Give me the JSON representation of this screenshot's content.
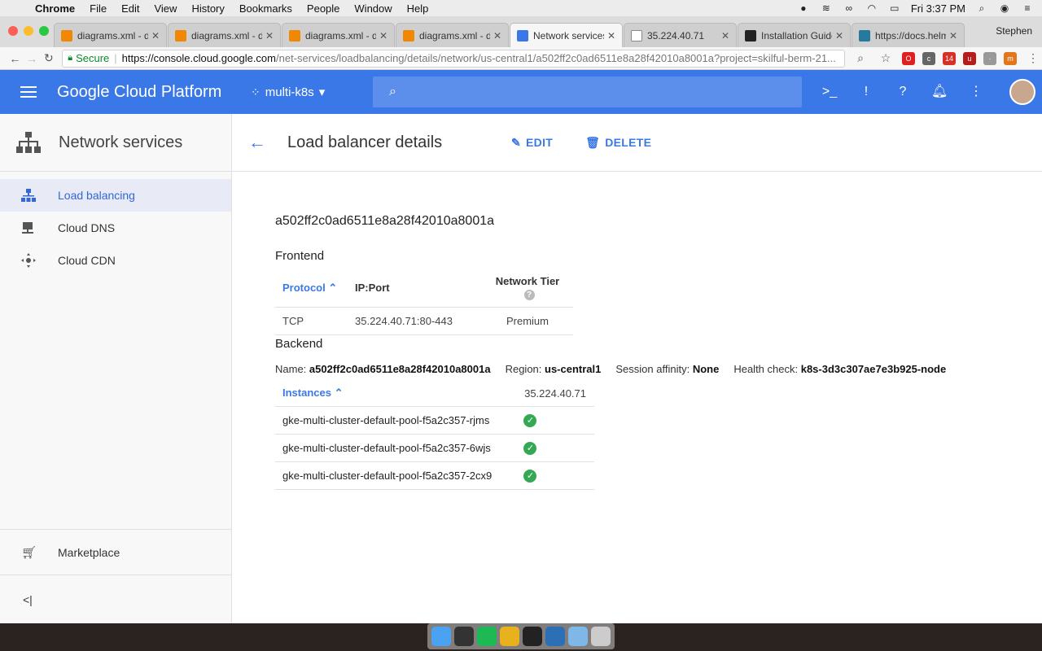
{
  "menubar": {
    "items": [
      "Chrome",
      "File",
      "Edit",
      "View",
      "History",
      "Bookmarks",
      "People",
      "Window",
      "Help"
    ],
    "clock": "Fri 3:37 PM"
  },
  "browser": {
    "tabs": [
      {
        "title": "diagrams.xml - dr",
        "icon": "drawio-icon"
      },
      {
        "title": "diagrams.xml - dr",
        "icon": "drawio-icon"
      },
      {
        "title": "diagrams.xml - dr",
        "icon": "drawio-icon"
      },
      {
        "title": "diagrams.xml - dr",
        "icon": "drawio-icon"
      },
      {
        "title": "Network services",
        "icon": "network-icon",
        "active": true
      },
      {
        "title": "35.224.40.71",
        "icon": "page-icon"
      },
      {
        "title": "Installation Guide",
        "icon": "graduation-cap-icon"
      },
      {
        "title": "https://docs.helm",
        "icon": "helm-icon"
      }
    ],
    "profile": "Stephen",
    "secure_label": "Secure",
    "url_host": "https://console.cloud.google.com",
    "url_rest": "/net-services/loadbalancing/details/network/us-central1/a502ff2c0ad6511e8a28f42010a8001a?project=skilful-berm-21..."
  },
  "gcp": {
    "brand": "Google Cloud Platform",
    "project": "multi-k8s"
  },
  "sidebar": {
    "title": "Network services",
    "items": [
      {
        "label": "Load balancing",
        "active": true
      },
      {
        "label": "Cloud DNS"
      },
      {
        "label": "Cloud CDN"
      }
    ],
    "marketplace": "Marketplace",
    "collapse": "<|"
  },
  "page": {
    "title": "Load balancer details",
    "edit_label": "EDIT",
    "delete_label": "DELETE",
    "lb_name": "a502ff2c0ad6511e8a28f42010a8001a"
  },
  "frontend": {
    "title": "Frontend",
    "headers": {
      "protocol": "Protocol",
      "ipport": "IP:Port",
      "tier": "Network Tier"
    },
    "rows": [
      {
        "protocol": "TCP",
        "ipport": "35.224.40.71:80-443",
        "tier": "Premium"
      }
    ]
  },
  "backend": {
    "title": "Backend",
    "name_label": "Name:",
    "name_value": "a502ff2c0ad6511e8a28f42010a8001a",
    "region_label": "Region:",
    "region_value": "us-central1",
    "affinity_label": "Session affinity:",
    "affinity_value": "None",
    "health_label": "Health check:",
    "health_value": "k8s-3d3c307ae7e3b925-node",
    "instances_header": "Instances",
    "ip_header": "35.224.40.71",
    "instances": [
      "gke-multi-cluster-default-pool-f5a2c357-rjms",
      "gke-multi-cluster-default-pool-f5a2c357-6wjs",
      "gke-multi-cluster-default-pool-f5a2c357-2cx9"
    ]
  },
  "colors": {
    "accent": "#3b78e7",
    "healthy": "#34a853"
  }
}
